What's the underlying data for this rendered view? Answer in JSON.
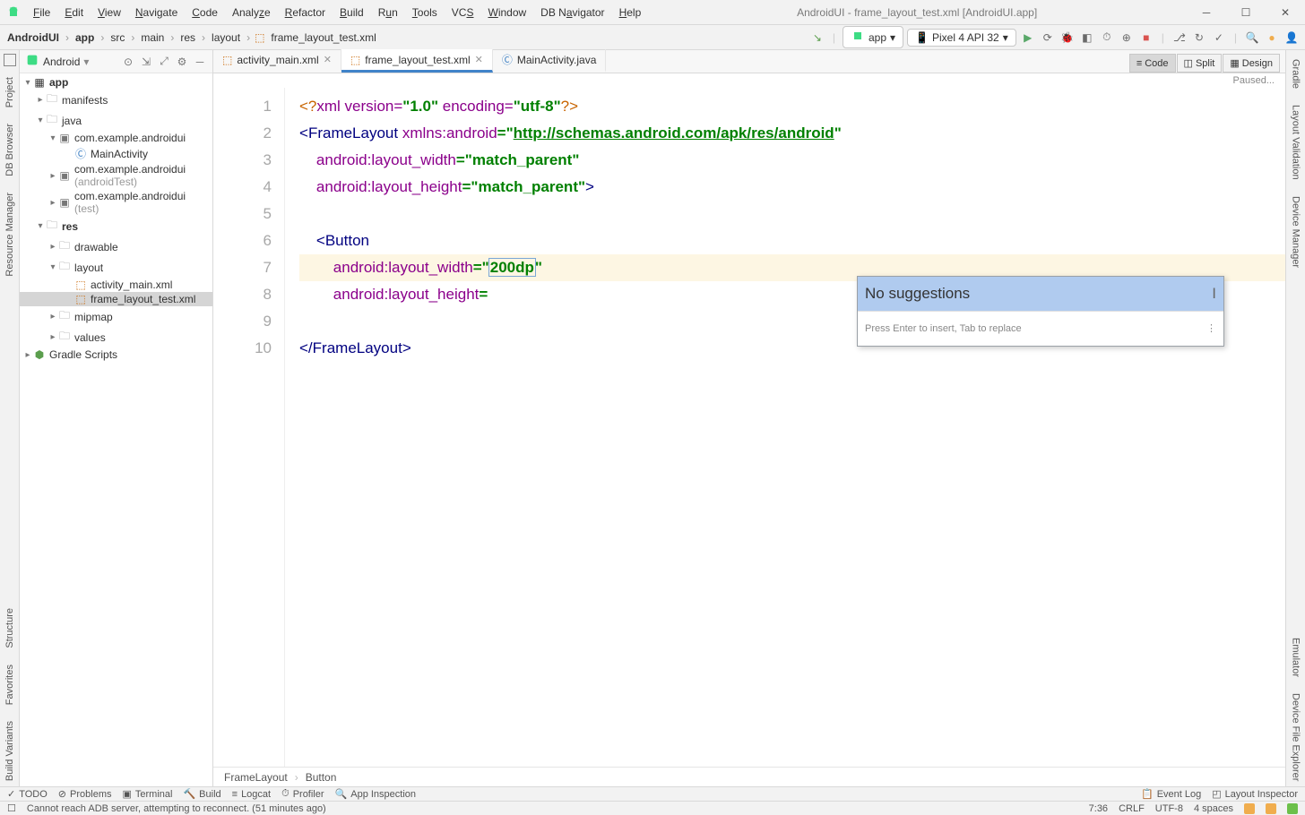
{
  "window": {
    "title": "AndroidUI - frame_layout_test.xml [AndroidUI.app]"
  },
  "menu": [
    "File",
    "Edit",
    "View",
    "Navigate",
    "Code",
    "Analyze",
    "Refactor",
    "Build",
    "Run",
    "Tools",
    "VCS",
    "Window",
    "DB Navigator",
    "Help"
  ],
  "breadcrumbs": [
    "AndroidUI",
    "app",
    "src",
    "main",
    "res",
    "layout",
    "frame_layout_test.xml"
  ],
  "toolbar": {
    "run_config": "app",
    "device": "Pixel 4 API 32"
  },
  "project_header": {
    "selector": "Android"
  },
  "tree": {
    "app": "app",
    "manifests": "manifests",
    "java": "java",
    "pkg_main": "com.example.androidui",
    "main_activity": "MainActivity",
    "pkg_androidtest": "com.example.androidui",
    "pkg_androidtest_suffix": " (androidTest)",
    "pkg_test": "com.example.androidui",
    "pkg_test_suffix": " (test)",
    "res": "res",
    "drawable": "drawable",
    "layout": "layout",
    "activity_main": "activity_main.xml",
    "frame_layout": "frame_layout_test.xml",
    "mipmap": "mipmap",
    "values": "values",
    "gradle": "Gradle Scripts"
  },
  "tabs": [
    {
      "label": "activity_main.xml",
      "active": false
    },
    {
      "label": "frame_layout_test.xml",
      "active": true
    },
    {
      "label": "MainActivity.java",
      "active": false
    }
  ],
  "viewmodes": {
    "code": "Code",
    "split": "Split",
    "design": "Design"
  },
  "editor_status": "Paused...",
  "code": {
    "l1a": "<?",
    "l1b": "xml version=",
    "l1c": "\"1.0\"",
    "l1d": " encoding=",
    "l1e": "\"utf-8\"",
    "l1f": "?>",
    "l2a": "<",
    "l2b": "FrameLayout ",
    "l2c": "xmlns:",
    "l2d": "android",
    "l2e": "=\"",
    "l2f": "http://schemas.android.com/apk/res/android",
    "l2g": "\"",
    "l3a": "    ",
    "l3b": "android",
    "l3c": ":layout_width",
    "l3d": "=\"",
    "l3e": "match_parent",
    "l3f": "\"",
    "l4a": "    ",
    "l4b": "android",
    "l4c": ":layout_height",
    "l4d": "=\"",
    "l4e": "match_parent",
    "l4f": "\"",
    "l4g": ">",
    "l6a": "    <",
    "l6b": "Button",
    "l7a": "        ",
    "l7b": "android",
    "l7c": ":layout_width",
    "l7d": "=\"",
    "l7e": "200dp",
    "l7f": "\"",
    "l8a": "        ",
    "l8b": "android",
    "l8c": ":layout_height",
    "l8d": "=",
    "l10a": "</",
    "l10b": "FrameLayout",
    "l10c": ">"
  },
  "line_numbers": [
    "1",
    "2",
    "3",
    "4",
    "5",
    "6",
    "7",
    "8",
    "9",
    "10"
  ],
  "popup": {
    "item": "No suggestions",
    "hint": "Press Enter to insert, Tab to replace",
    "menu": "⋮"
  },
  "code_breadcrumb": [
    "FrameLayout",
    "Button"
  ],
  "left_tools": [
    "Project",
    "DB Browser",
    "Resource Manager"
  ],
  "right_tools": [
    "Gradle",
    "Layout Validation",
    "Device Manager",
    "Emulator",
    "Device File Explorer"
  ],
  "left_tools2": [
    "Structure",
    "Favorites",
    "Build Variants"
  ],
  "bottom_tools": [
    "TODO",
    "Problems",
    "Terminal",
    "Build",
    "Logcat",
    "Profiler",
    "App Inspection"
  ],
  "bottom_right": [
    "Event Log",
    "Layout Inspector"
  ],
  "status": {
    "message": "Cannot reach ADB server, attempting to reconnect. (51 minutes ago)",
    "pos": "7:36",
    "crlf": "CRLF",
    "enc": "UTF-8",
    "indent": "4 spaces"
  }
}
